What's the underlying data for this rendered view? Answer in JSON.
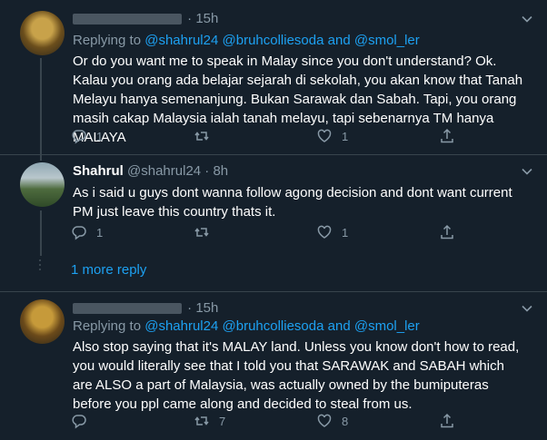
{
  "tweets": [
    {
      "time": "15h",
      "replying_label": "Replying to",
      "mentions": [
        "@shahrul24",
        "@bruhcolliesoda",
        "and",
        "@smol_ler"
      ],
      "text": "Or do you want me to speak in Malay since you don't understand? Ok. Kalau you orang ada belajar sejarah di sekolah, you akan know that Tanah Melayu hanya semenanjung. Bukan Sarawak dan Sabah. Tapi, you orang masih cakap Malaysia ialah tanah melayu, tapi sebenarnya TM hanya MALAYA",
      "reply_count": "1",
      "retweet_count": "",
      "like_count": "1"
    },
    {
      "name": "Shahrul",
      "handle": "@shahrul24",
      "dot": "·",
      "time": "8h",
      "text": "As i said u guys dont wanna follow agong decision and dont want current PM just leave this country thats it.",
      "reply_count": "1",
      "retweet_count": "",
      "like_count": "1"
    },
    {
      "time": "15h",
      "replying_label": "Replying to",
      "mentions": [
        "@shahrul24",
        "@bruhcolliesoda",
        "and",
        "@smol_ler"
      ],
      "text": "Also stop saying that it's MALAY land. Unless you know don't how to read, you would literally see that I told you that SARAWAK and SABAH which are ALSO a part of Malaysia, was actually owned by the bumiputeras before you ppl came along and decided to steal from us.",
      "reply_count": "",
      "retweet_count": "7",
      "like_count": "8"
    }
  ],
  "more_replies": "1 more reply",
  "colors": {
    "background": "#15202b",
    "link": "#1da1f2",
    "muted": "#8899a6",
    "divider": "#38444d"
  },
  "icons": [
    "reply-icon",
    "retweet-icon",
    "like-icon",
    "share-icon",
    "chevron-down-icon"
  ]
}
